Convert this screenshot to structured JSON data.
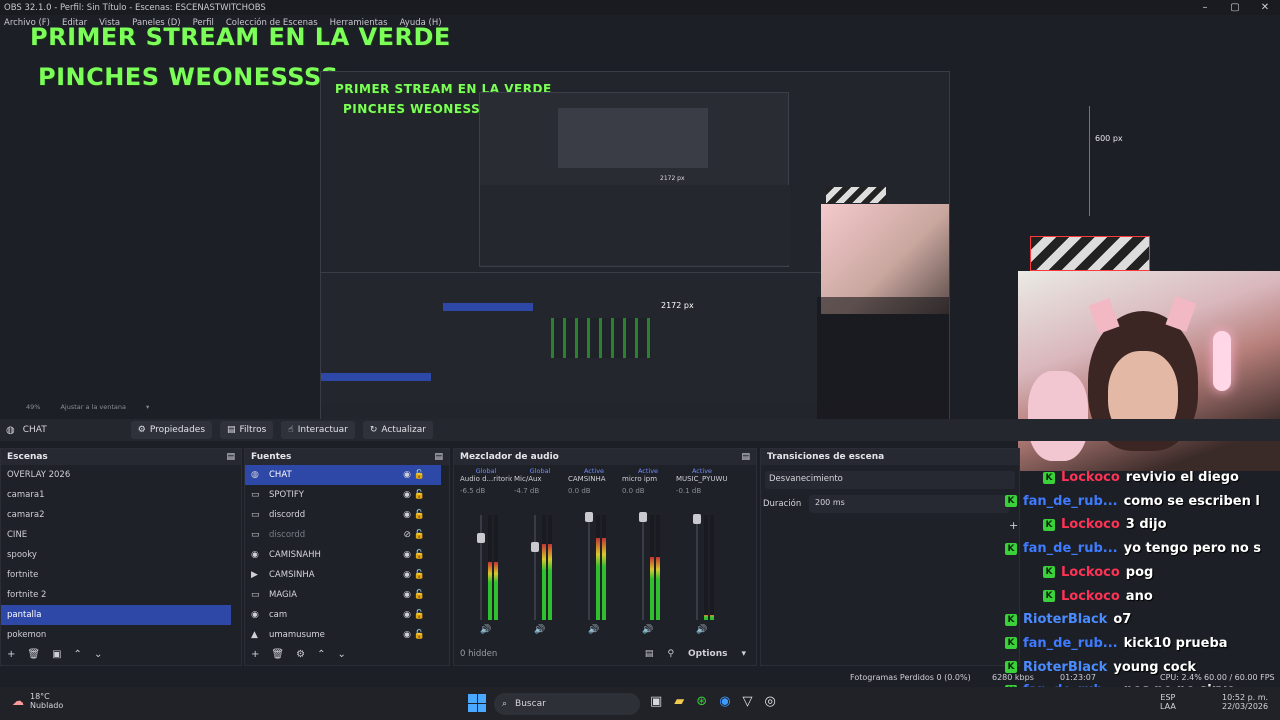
{
  "window": {
    "title": "OBS 32.1.0 - Perfil: Sin Título - Escenas: ESCENASTWITCHOBS"
  },
  "menu": [
    "Archivo (F)",
    "Editar",
    "Vista",
    "Paneles (D)",
    "Perfil",
    "Colección de Escenas",
    "Herramientas",
    "Ayuda (H)"
  ],
  "overlay": {
    "line1": "PRIMER STREAM EN LA VERDE",
    "line2": "PINCHES WEONESSSS"
  },
  "preview": {
    "px_label": "600 px",
    "px_label2": "2172 px",
    "zoom": "49%",
    "fit_label": "Ajustar a la ventana"
  },
  "context_bar": {
    "source": "CHAT",
    "properties": "Propiedades",
    "filters": "Filtros",
    "interact": "Interactuar",
    "refresh": "Actualizar"
  },
  "scenes": {
    "title": "Escenas",
    "items": [
      "OVERLAY 2026",
      "camara1",
      "camara2",
      "CINE",
      "spooky",
      "fortnite",
      "fortnite 2",
      "pantalla",
      "pokemon"
    ],
    "selected": "pantalla"
  },
  "sources": {
    "title": "Fuentes",
    "items": [
      {
        "label": "CHAT",
        "icon": "browser-icon",
        "glyph": "◍",
        "hidden": false
      },
      {
        "label": "SPOTIFY",
        "icon": "window-icon",
        "glyph": "▭",
        "hidden": false
      },
      {
        "label": "discordd",
        "icon": "window-icon",
        "glyph": "▭",
        "hidden": false
      },
      {
        "label": "discordd",
        "icon": "window-icon",
        "glyph": "▭",
        "hidden": true
      },
      {
        "label": "CAMISNAHH",
        "icon": "camera-icon",
        "glyph": "◉",
        "hidden": false
      },
      {
        "label": "CAMSINHA",
        "icon": "media-play-icon",
        "glyph": "▶",
        "hidden": false
      },
      {
        "label": "MAGIA",
        "icon": "window-icon",
        "glyph": "▭",
        "hidden": false
      },
      {
        "label": "cam",
        "icon": "camera-icon",
        "glyph": "◉",
        "hidden": false
      },
      {
        "label": "umamusume",
        "icon": "game-icon",
        "glyph": "▲",
        "hidden": false
      }
    ]
  },
  "mixer": {
    "title": "Mezclador de audio",
    "hidden_label": "0 hidden",
    "options_label": "Options",
    "channels": [
      {
        "badge": "Global",
        "label": "Audio d...ritorio",
        "db": "-6.5 dB",
        "level": 0.55,
        "fader": 0.78
      },
      {
        "badge": "Global",
        "label": "Mic/Aux",
        "db": "-4.7 dB",
        "level": 0.72,
        "fader": 0.7
      },
      {
        "badge": "Active",
        "label": "CAMSINHA",
        "db": "0.0 dB",
        "level": 0.78,
        "fader": 0.98
      },
      {
        "badge": "Active",
        "label": "micro ipm",
        "db": "0.0 dB",
        "level": 0.6,
        "fader": 0.98
      },
      {
        "badge": "Active",
        "label": "MUSIC_PYUWU",
        "db": "-0.1 dB",
        "level": 0.05,
        "fader": 0.96
      }
    ]
  },
  "transitions": {
    "title": "Transiciones de escena",
    "type": "Desvanecimiento",
    "duration_label": "Duración",
    "duration_value": "200 ms"
  },
  "chat": [
    {
      "user": "Lockoco",
      "msg": "revivio el diego",
      "color": "#ff3355"
    },
    {
      "user": "fan_de_rub...",
      "msg": "como se escriben l",
      "color": "#3e7bff"
    },
    {
      "user": "Lockoco",
      "msg": "3 dijo",
      "color": "#ff3355"
    },
    {
      "user": "fan_de_rub...",
      "msg": "yo tengo pero no s",
      "color": "#3e7bff"
    },
    {
      "user": "Lockoco",
      "msg": "pog",
      "color": "#ff3355"
    },
    {
      "user": "Lockoco",
      "msg": "ano",
      "color": "#ff3355"
    },
    {
      "user": "RioterBlack",
      "msg": "o7",
      "color": "#4a8bff"
    },
    {
      "user": "fan_de_rub...",
      "msg": "kick10 prueba",
      "color": "#3e7bff"
    },
    {
      "user": "RioterBlack",
      "msg": "young cock",
      "color": "#4a8bff"
    },
    {
      "user": "fan_de_rub...",
      "msg": "pos no no sirve",
      "color": "#3e7bff"
    }
  ],
  "status": {
    "dropped": "Fotogramas Perdidos 0 (0.0%)",
    "bitrate": "6280 kbps",
    "time": "01:23:07",
    "cpu": "CPU: 2.4%",
    "fps": "60.00 / 60.00 FPS"
  },
  "taskbar": {
    "weather_temp": "18°C",
    "weather_desc": "Nublado",
    "search": "Buscar",
    "lang": "ESP",
    "lang2": "LAA",
    "clock_time": "10:52 p. m.",
    "clock_date": "22/03/2026"
  },
  "colors": {
    "accent": "#2e48a8",
    "overlay_green": "#7dff5a",
    "kick_green": "#3ad13a"
  }
}
